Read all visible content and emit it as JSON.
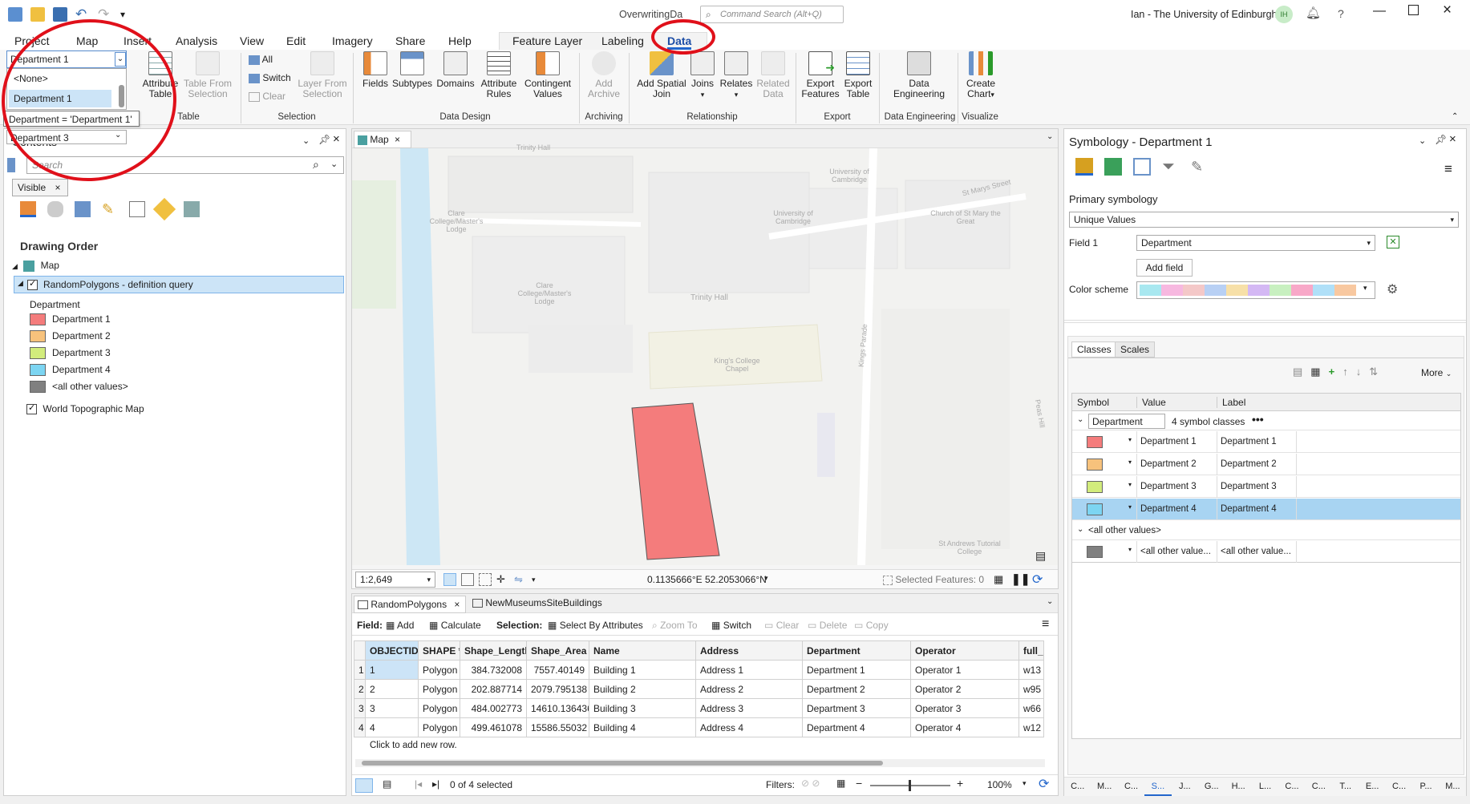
{
  "window": {
    "title": "OverwritingDa",
    "command_search_placeholder": "Command Search (Alt+Q)",
    "user": "Ian - The University of Edinburgh",
    "user_initials": "IH",
    "help": "?"
  },
  "ribbon_tabs": [
    "Project",
    "Map",
    "Insert",
    "Analysis",
    "View",
    "Edit",
    "Imagery",
    "Share",
    "Help",
    "Feature Layer",
    "Labeling",
    "Data"
  ],
  "ribbon": {
    "layer_combo_value": "Department 1",
    "table_group": "Table",
    "attribute_table": "Attribute Table",
    "table_from_selection": "Table From Selection",
    "selection_group": "Selection",
    "all": "All",
    "switch": "Switch",
    "clear": "Clear",
    "layer_from_selection": "Layer From Selection",
    "data_design_group": "Data Design",
    "fields": "Fields",
    "subtypes": "Subtypes",
    "domains": "Domains",
    "attribute_rules": "Attribute Rules",
    "contingent_values": "Contingent Values",
    "archiving_group": "Archiving",
    "add_archive": "Add Archive",
    "relationship_group": "Relationship",
    "add_spatial_join": "Add Spatial Join",
    "joins": "Joins",
    "relates": "Relates",
    "related_data": "Related Data",
    "export_group": "Export",
    "export_features": "Export Features",
    "export_table": "Export Table",
    "data_engineering_group": "Data Engineering",
    "data_engineering": "Data Engineering",
    "visualize_group": "Visualize",
    "create_chart": "Create Chart"
  },
  "dropdown": {
    "options": [
      "<None>",
      "Department 1"
    ],
    "tooltip": "Department = 'Department 1'",
    "next_value": "Department 3"
  },
  "contents": {
    "title": "Contents",
    "search_placeholder": "Search",
    "filter_chip": "Visible",
    "drawing_order": "Drawing Order",
    "map_item": "Map",
    "layer_name": "RandomPolygons - definition query",
    "legend_heading": "Department",
    "legend": [
      {
        "label": "Department 1",
        "color": "#f47c7c"
      },
      {
        "label": "Department 2",
        "color": "#f7c27c"
      },
      {
        "label": "Department 3",
        "color": "#d2ec7c"
      },
      {
        "label": "Department 4",
        "color": "#7cd5f2"
      },
      {
        "label": "<all other values>",
        "color": "#808080"
      }
    ],
    "basemap": "World Topographic Map"
  },
  "map": {
    "tab": "Map",
    "labels": [
      "Trinity Hall",
      "University of Cambridge",
      "St Marys Street",
      "Clare College/Master's Lodge",
      "University of Cambridge",
      "Church of St Mary the Great",
      "Clare College/Master's Lodge",
      "Trinity Hall",
      "King's College Chapel",
      "Kings Parade",
      "Peas Hill",
      "St Andrews Tutorial College"
    ],
    "polygon_color": "#f47c7c",
    "scale": "1:2,649",
    "coords": "0.1135666°E 52.2053066°N",
    "selected_features": "Selected Features: 0"
  },
  "table": {
    "tabs": [
      "RandomPolygons",
      "NewMuseumsSiteBuildings"
    ],
    "field_label": "Field:",
    "add": "Add",
    "calculate": "Calculate",
    "selection_label": "Selection:",
    "select_by_attributes": "Select By Attributes",
    "zoom_to": "Zoom To",
    "switch": "Switch",
    "clear": "Clear",
    "delete": "Delete",
    "copy": "Copy",
    "columns": [
      "OBJECTID *",
      "SHAPE *",
      "Shape_Length",
      "Shape_Area",
      "Name",
      "Address",
      "Department",
      "Operator",
      "full_"
    ],
    "rows": [
      [
        "1",
        "1",
        "Polygon",
        "384.732008",
        "7557.40149",
        "Building 1",
        "Address 1",
        "Department 1",
        "Operator 1",
        "w13"
      ],
      [
        "2",
        "2",
        "Polygon",
        "202.887714",
        "2079.795138",
        "Building 2",
        "Address 2",
        "Department 2",
        "Operator 2",
        "w95"
      ],
      [
        "3",
        "3",
        "Polygon",
        "484.002773",
        "14610.136436",
        "Building 3",
        "Address 3",
        "Department 3",
        "Operator 3",
        "w66"
      ],
      [
        "4",
        "4",
        "Polygon",
        "499.461078",
        "15586.55032",
        "Building 4",
        "Address 4",
        "Department 4",
        "Operator 4",
        "w12"
      ]
    ],
    "add_row": "Click to add new row.",
    "selected_status": "0 of 4 selected",
    "filters": "Filters:",
    "zoom": "100%"
  },
  "symbology": {
    "title": "Symbology - Department 1",
    "primary": "Primary symbology",
    "method": "Unique Values",
    "field1_label": "Field 1",
    "field1_value": "Department",
    "add_field": "Add field",
    "color_scheme_label": "Color scheme",
    "color_scheme": [
      "#a8e8f0",
      "#f7b8e0",
      "#f4c8c8",
      "#b8d0f4",
      "#f7e0a8",
      "#d4b8f4",
      "#c8f0c0",
      "#f8a8c8",
      "#b0e0f8",
      "#f8c8a0"
    ],
    "tabs": [
      "Classes",
      "Scales"
    ],
    "more": "More",
    "columns": [
      "Symbol",
      "Value",
      "Label"
    ],
    "group_name": "Department",
    "group_count": "4 symbol classes",
    "classes": [
      {
        "value": "Department 1",
        "label": "Department 1",
        "color": "#f47c7c"
      },
      {
        "value": "Department 2",
        "label": "Department 2",
        "color": "#f7c27c"
      },
      {
        "value": "Department 3",
        "label": "Department 3",
        "color": "#d2ec7c"
      },
      {
        "value": "Department 4",
        "label": "Department 4",
        "color": "#7cd5f2"
      }
    ],
    "other_group": "<all other values>",
    "other_value": "<all other value...",
    "other_label": "<all other value...",
    "other_color": "#808080",
    "bottom_tabs": [
      "C...",
      "M...",
      "C...",
      "S...",
      "J...",
      "G...",
      "H...",
      "L...",
      "C...",
      "C...",
      "T...",
      "E...",
      "C...",
      "P...",
      "M..."
    ]
  }
}
